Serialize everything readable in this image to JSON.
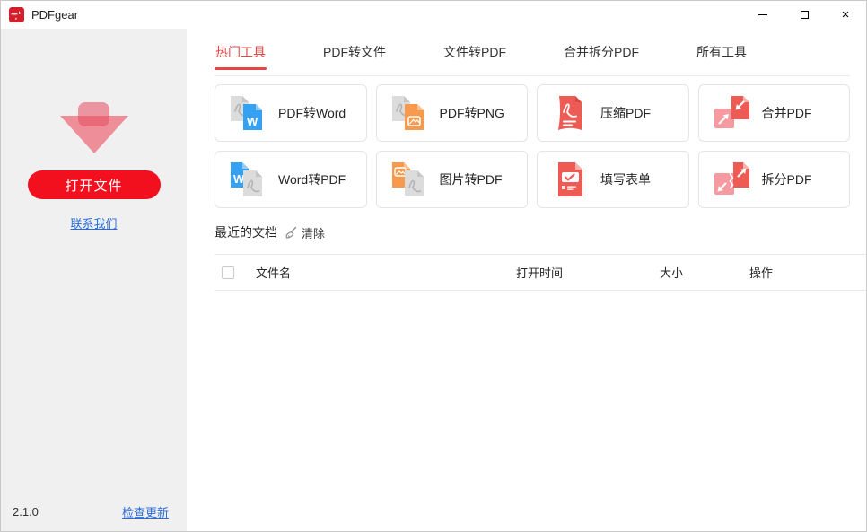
{
  "titlebar": {
    "app_name": "PDFgear"
  },
  "sidebar": {
    "open_button": "打开文件",
    "contact_link": "联系我们",
    "version": "2.1.0",
    "update_link": "检查更新"
  },
  "tabs": [
    {
      "label": "热门工具",
      "active": true
    },
    {
      "label": "PDF转文件",
      "active": false
    },
    {
      "label": "文件转PDF",
      "active": false
    },
    {
      "label": "合并拆分PDF",
      "active": false
    },
    {
      "label": "所有工具",
      "active": false
    }
  ],
  "tools": [
    {
      "label": "PDF转Word",
      "icon": "pdf-to-word-icon"
    },
    {
      "label": "PDF转PNG",
      "icon": "pdf-to-png-icon"
    },
    {
      "label": "压缩PDF",
      "icon": "compress-pdf-icon"
    },
    {
      "label": "合并PDF",
      "icon": "merge-pdf-icon"
    },
    {
      "label": "Word转PDF",
      "icon": "word-to-pdf-icon"
    },
    {
      "label": "图片转PDF",
      "icon": "image-to-pdf-icon"
    },
    {
      "label": "填写表单",
      "icon": "fill-form-icon"
    },
    {
      "label": "拆分PDF",
      "icon": "split-pdf-icon"
    }
  ],
  "recent": {
    "title": "最近的文档",
    "clear_label": "清除",
    "clear_icon": "broom-icon"
  },
  "table": {
    "headers": [
      "文件名",
      "打开时间",
      "大小",
      "操作"
    ],
    "rows": []
  },
  "colors": {
    "accent_red": "#f2101f",
    "tab_active_red": "#e64545",
    "link_blue": "#2b6bd9",
    "sidebar_bg": "#f0f0f0",
    "icon_red": "#ee5b55",
    "icon_pink": "#f59aa1",
    "icon_blue": "#35a1f3",
    "icon_orange": "#f79a4d"
  }
}
